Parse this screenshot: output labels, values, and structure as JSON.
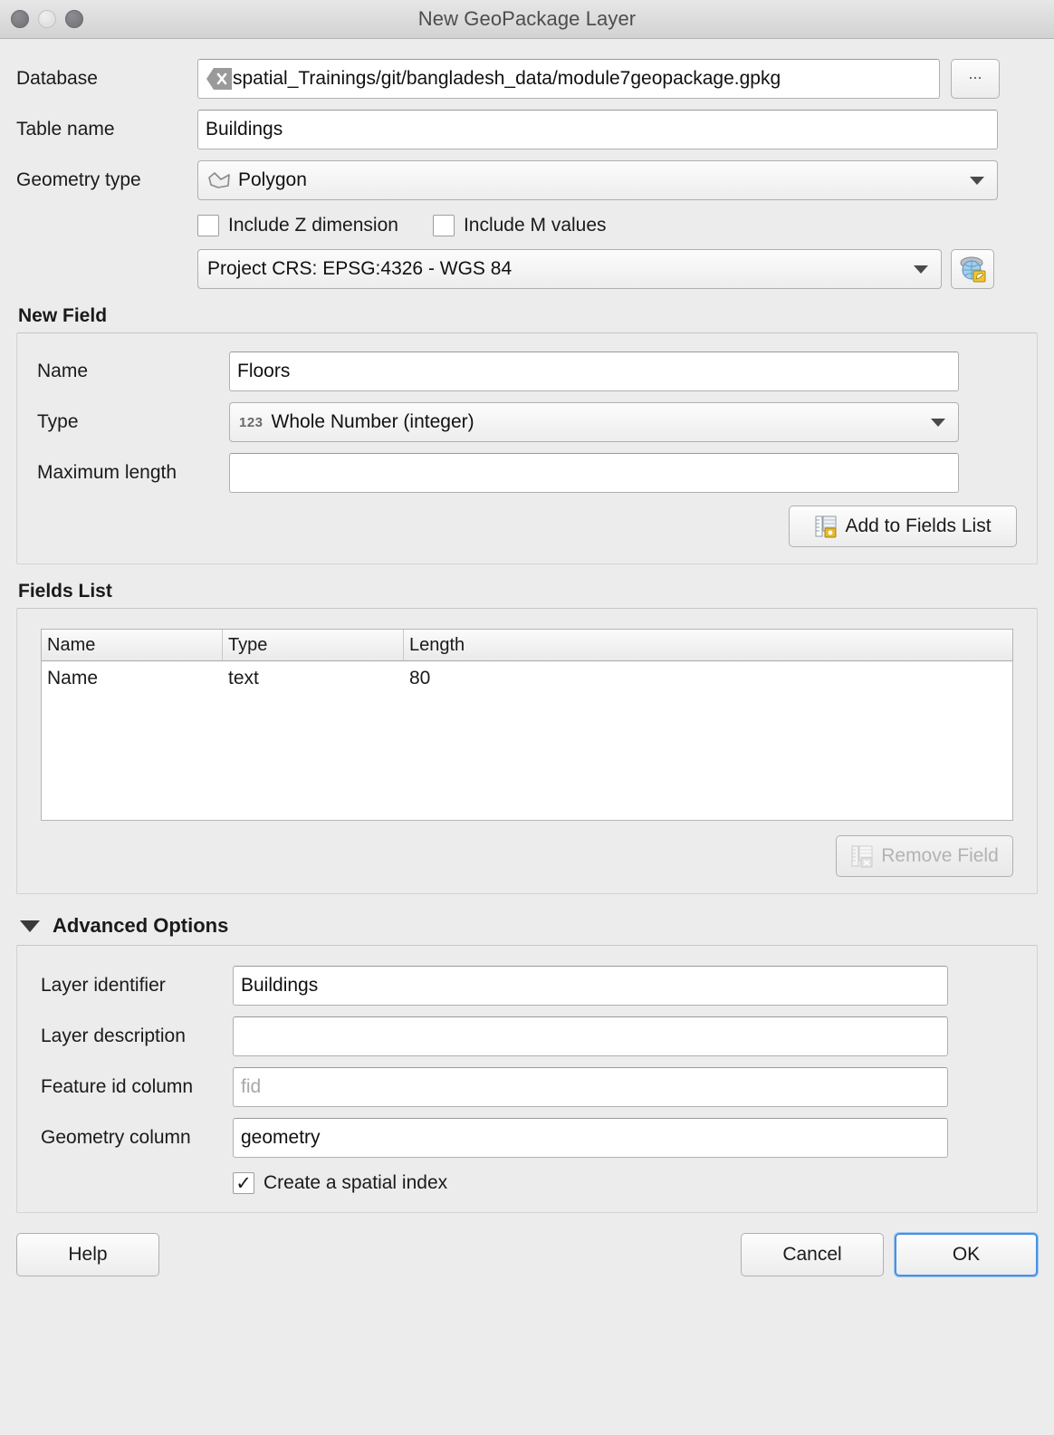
{
  "window": {
    "title": "New GeoPackage Layer",
    "controls": {
      "close": "close-button",
      "minimize": "minimize-button",
      "zoom": "zoom-button"
    }
  },
  "form": {
    "database": {
      "label": "Database",
      "value": "spatial_Trainings/git/bangladesh_data/module7geopackage.gpkg",
      "clear_icon": "clear-icon",
      "browse_label": "..."
    },
    "table_name": {
      "label": "Table name",
      "value": "Buildings"
    },
    "geometry_type": {
      "label": "Geometry type",
      "value": "Polygon",
      "icon": "polygon-icon"
    },
    "include_z": {
      "label": "Include Z dimension",
      "checked": false
    },
    "include_m": {
      "label": "Include M values",
      "checked": false
    },
    "crs": {
      "value": "Project CRS: EPSG:4326 - WGS 84",
      "select_icon": "globe-edit-icon"
    }
  },
  "new_field": {
    "title": "New Field",
    "name": {
      "label": "Name",
      "value": "Floors"
    },
    "type": {
      "label": "Type",
      "value": "Whole Number (integer)",
      "icon": "123-icon"
    },
    "max_length": {
      "label": "Maximum length",
      "value": ""
    },
    "add_button": {
      "label": "Add to Fields List",
      "icon": "add-field-icon"
    }
  },
  "fields_list": {
    "title": "Fields List",
    "columns": [
      "Name",
      "Type",
      "Length"
    ],
    "rows": [
      {
        "name": "Name",
        "type": "text",
        "length": "80"
      }
    ],
    "remove_button": {
      "label": "Remove Field",
      "icon": "remove-field-icon",
      "enabled": false
    }
  },
  "advanced_options": {
    "title": "Advanced Options",
    "expanded": true,
    "layer_identifier": {
      "label": "Layer identifier",
      "value": "Buildings"
    },
    "layer_description": {
      "label": "Layer description",
      "value": ""
    },
    "feature_id_column": {
      "label": "Feature id column",
      "placeholder": "fid",
      "value": ""
    },
    "geometry_column": {
      "label": "Geometry column",
      "value": "geometry"
    },
    "spatial_index": {
      "label": "Create a spatial index",
      "checked": true
    }
  },
  "footer": {
    "help": "Help",
    "cancel": "Cancel",
    "ok": "OK"
  },
  "colors": {
    "dialog_bg": "#ececec",
    "focus_blue": "#4a90e2",
    "accent_yellow": "#e8c54a"
  }
}
